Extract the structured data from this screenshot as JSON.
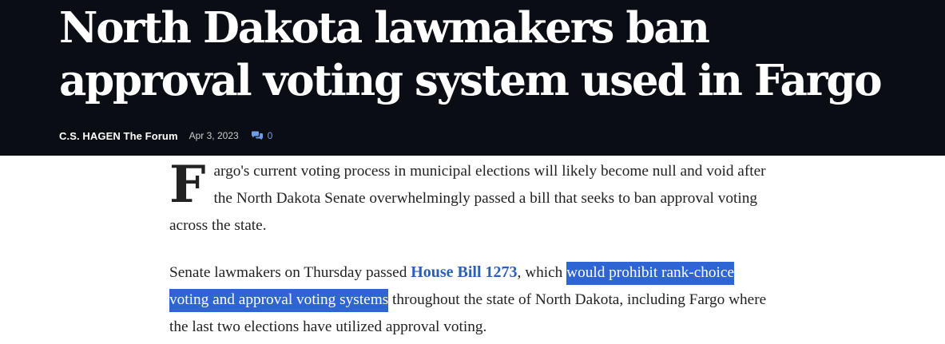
{
  "article": {
    "headline": "North Dakota lawmakers ban approval voting system used in Fargo",
    "author": "C.S. HAGEN The Forum",
    "date": "Apr 3, 2023",
    "comment_count": "0",
    "comment_icon": "comments-icon",
    "paragraph1": {
      "dropcap": "F",
      "text": "argo's current voting process in municipal elections will likely become null and void after the North Dakota Senate overwhelmingly passed a bill that seeks to ban approval voting across the state."
    },
    "paragraph2": {
      "text_before": "Senate lawmakers on Thursday passed ",
      "link_text": "House Bill 1273",
      "text_after_link": ", which ",
      "highlighted_text": "would prohibit rank-choice voting and approval voting systems",
      "text_after": " throughout the state of North Dakota, including Fargo where the last two elections have utilized approval voting."
    }
  },
  "colors": {
    "header_bg": "#0a0e14",
    "link": "#2a60b6",
    "selection_highlight": "#2f64d4",
    "comment_accent": "#6f9ce8"
  }
}
